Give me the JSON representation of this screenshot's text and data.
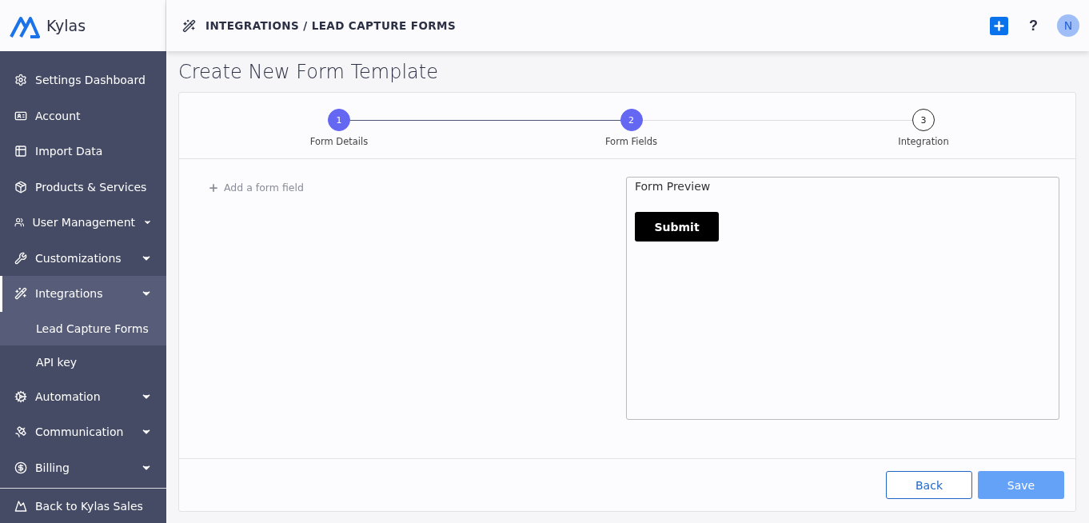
{
  "brand": {
    "name": "Kylas"
  },
  "header": {
    "breadcrumb": "INTEGRATIONS / LEAD CAPTURE FORMS",
    "avatar": "N",
    "help": "?"
  },
  "sidebar": {
    "items": [
      {
        "label": "Settings Dashboard",
        "kind": "link",
        "selected": false
      },
      {
        "label": "Account",
        "kind": "link",
        "selected": false
      },
      {
        "label": "Import Data",
        "kind": "link",
        "selected": false
      },
      {
        "label": "Products & Services",
        "kind": "link",
        "selected": false
      },
      {
        "label": "User Management",
        "kind": "menu",
        "selected": false
      },
      {
        "label": "Customizations",
        "kind": "menu",
        "selected": false
      },
      {
        "label": "Integrations",
        "kind": "menu",
        "selected": true,
        "children": [
          {
            "label": "Lead Capture Forms",
            "selected": true
          },
          {
            "label": "API key",
            "selected": false
          }
        ]
      },
      {
        "label": "Automation",
        "kind": "menu",
        "selected": false
      },
      {
        "label": "Communication",
        "kind": "menu",
        "selected": false
      },
      {
        "label": "Billing",
        "kind": "menu",
        "selected": false
      }
    ],
    "footer": {
      "label": "Back to Kylas Sales"
    }
  },
  "page": {
    "title": "Create New Form Template"
  },
  "steps": [
    {
      "number": "1",
      "label": "Form Details",
      "completed": true
    },
    {
      "number": "2",
      "label": "Form Fields",
      "completed": true
    },
    {
      "number": "3",
      "label": "Integration",
      "completed": false
    }
  ],
  "add_field": {
    "label": "Add a form field"
  },
  "preview": {
    "title": "Form Preview",
    "submit": "Submit"
  },
  "buttons": [
    {
      "label": "Back",
      "kind": "secondary",
      "disabled": false
    },
    {
      "label": "Save",
      "kind": "primary",
      "disabled": true
    }
  ]
}
